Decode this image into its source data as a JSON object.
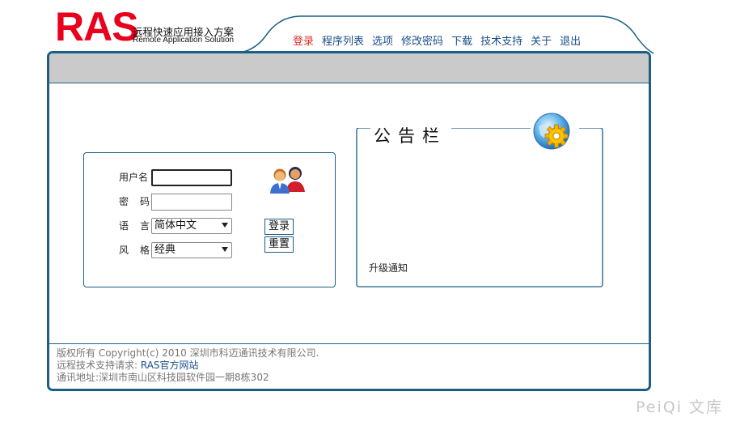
{
  "logo": {
    "brand": "RAS",
    "cn_title": "远程快速应用接入方案",
    "en_title": "Remote Application Solution"
  },
  "nav": {
    "items": [
      {
        "label": "登录",
        "active": true
      },
      {
        "label": "程序列表"
      },
      {
        "label": "选项"
      },
      {
        "label": "修改密码"
      },
      {
        "label": "下载"
      },
      {
        "label": "技术支持"
      },
      {
        "label": "关于"
      },
      {
        "label": "退出"
      }
    ]
  },
  "login": {
    "username_label": "用户名",
    "password_label_1": "密",
    "password_label_2": "码",
    "language_label_1": "语",
    "language_label_2": "言",
    "style_label_1": "风",
    "style_label_2": "格",
    "username_value": "",
    "password_value": "",
    "language_selected": "简体中文",
    "style_selected": "经典",
    "login_button": "登录",
    "reset_button": "重置"
  },
  "notice": {
    "title": "公告栏",
    "items": [
      "升级通知"
    ]
  },
  "footer": {
    "copyright": "版权所有 Copyright(c) 2010 深圳市科迈通讯技术有限公司.",
    "support_prefix": "远程技术支持请求:",
    "support_link": "RAS官方网站",
    "address": "通讯地址:深圳市南山区科技园软件园一期8栋302"
  },
  "watermark": "PeiQi 文库",
  "colors": {
    "brand_red": "#e8001c",
    "frame_blue": "#1b5f86",
    "nav_text": "#1a4f8a",
    "nav_active": "#e03030",
    "topbar_gray": "#cacaca"
  }
}
